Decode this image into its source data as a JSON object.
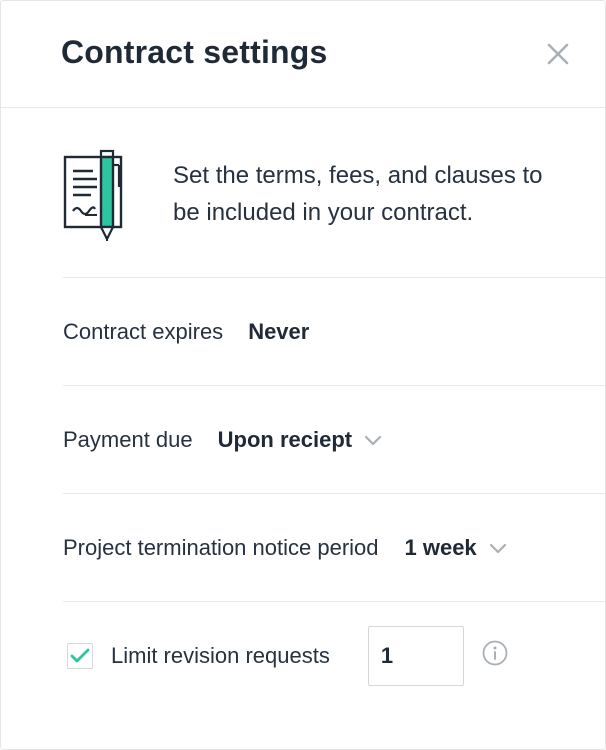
{
  "header": {
    "title": "Contract settings",
    "close_icon": "close-icon"
  },
  "intro": {
    "icon": "notebook-pen-icon",
    "text": "Set the terms, fees, and clauses to be included in your contract."
  },
  "settings": {
    "contract_expires": {
      "label": "Contract expires",
      "value": "Never"
    },
    "payment_due": {
      "label": "Payment due",
      "value": "Upon reciept"
    },
    "termination_notice": {
      "label": "Project termination notice period",
      "value": "1 week"
    },
    "revision_limit": {
      "label": "Limit revision requests",
      "checked": true,
      "value": "1",
      "info_icon": "info-icon"
    }
  },
  "colors": {
    "accent": "#2ec4a0",
    "text": "#1f2a36",
    "divider": "#e6e9ec",
    "icon_gray": "#a9b0b7"
  }
}
